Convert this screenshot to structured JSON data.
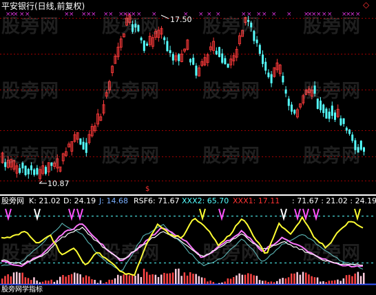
{
  "main": {
    "title": "平安银行(日线,前复权)",
    "high_label": "17.50",
    "low_label": "10.87",
    "signal_mark": "$",
    "diamond_icon": "◇"
  },
  "indicator": {
    "name": "股旁网",
    "k_label": "K: 21.02",
    "d_label": "D: 24.19",
    "j_label": "J: 14.68",
    "rsf_label": "RSF6: 71.67",
    "xxx2_label": "XXX2: 65.70",
    "xxx1_label": "XXX1: 17.11",
    "tail_label": ": 71.67 : 21.02 : 24.19",
    "footer": "股旁网学指标"
  },
  "watermark": "股旁网",
  "colors": {
    "up": "#ff3a3a",
    "down": "#54ffff",
    "grid": "#a00000",
    "k": "#ffffff",
    "d": "#ffff33",
    "j": "#ff55ff",
    "xxx2": "#55ffff",
    "xxx1": "#ff3333"
  }
}
